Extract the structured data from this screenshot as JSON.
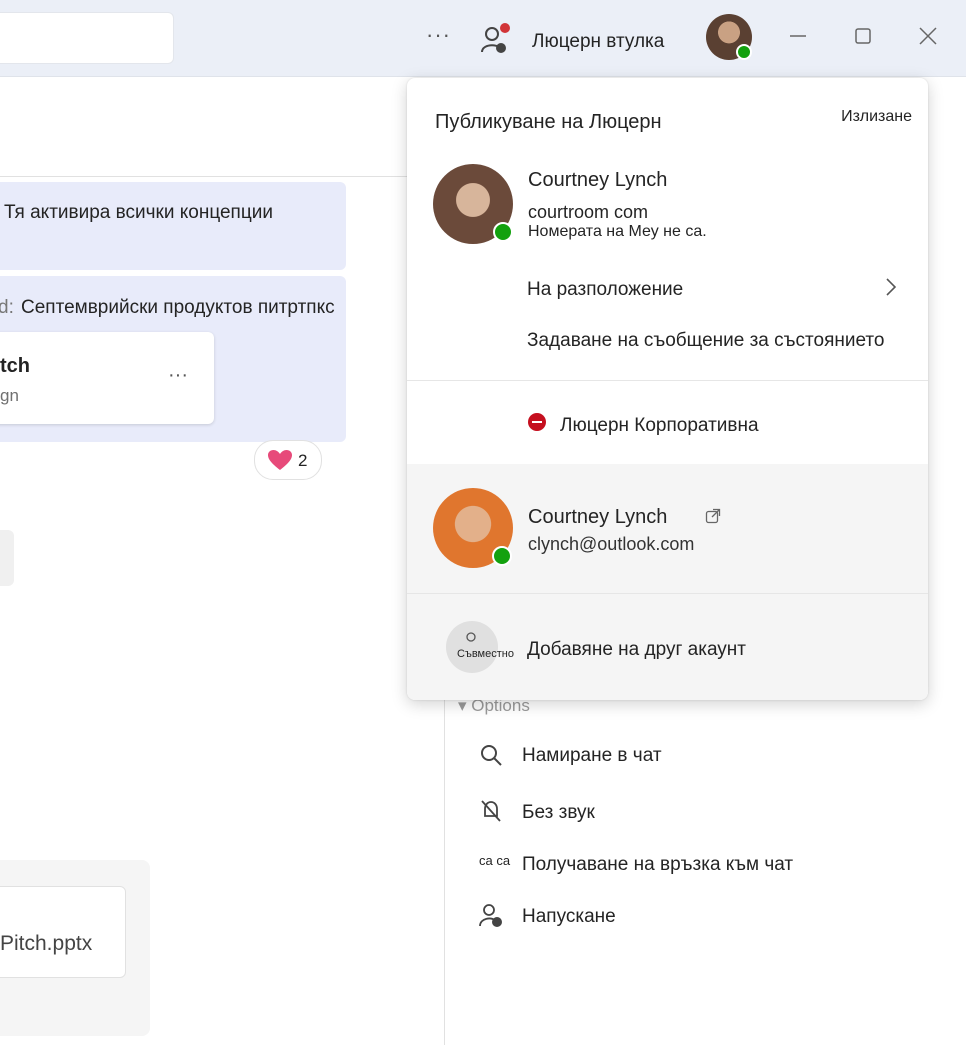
{
  "titlebar": {
    "more_label": "···",
    "account_name": "Люцерн втулка"
  },
  "chat": {
    "message1": "Тя активира всички концепции",
    "message2_prefix": "d:",
    "message2": "Септемврийски продуктов питртпкс",
    "file_card_title": "tch",
    "file_card_sub": "gn",
    "file_card_more": "···",
    "reaction_count": "2",
    "attachment_name": "Pitch.pptx"
  },
  "right_pane": {
    "options_label": "▾ Options",
    "items": [
      {
        "label": "Намиране в чат",
        "icon": "search-icon"
      },
      {
        "label": "Без звук",
        "icon": "bell-off-icon"
      },
      {
        "label": "Получаване на връзка към чат",
        "icon": "link-icon",
        "icon_text": "са са"
      },
      {
        "label": "Напускане",
        "icon": "leave-icon"
      }
    ]
  },
  "flyout": {
    "org_name": "Публикуване на Люцерн",
    "sign_out": "Излизане",
    "primary": {
      "name": "Courtney Lynch",
      "email": "courtroom com",
      "status_message": "Номерата на Меу не са."
    },
    "location_label": "На разположение",
    "status_message_label": "Задаване на съобщение за състоянието",
    "tenant_label": "Люцерн Корпоративна",
    "secondary": {
      "name": "Courtney Lynch",
      "email": "clynch@outlook.com"
    },
    "add_account_icon_text": "Съвместно",
    "add_account_label": "Добавяне на друг акаунт"
  },
  "colors": {
    "accent_bubble": "#e8ebfa",
    "presence_available": "#13a10e",
    "dnd_red": "#c50f1f"
  }
}
